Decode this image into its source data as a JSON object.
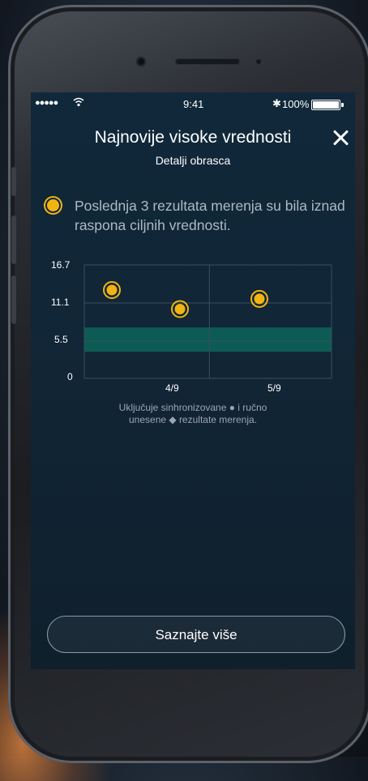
{
  "status_bar": {
    "signal": "●●●●●",
    "time": "9:41",
    "bluetooth": "✱",
    "battery_text": "100%",
    "battery_level": 1.0
  },
  "header": {
    "title": "Najnovije visoke vrednosti",
    "subtitle": "Detalji obrasca"
  },
  "message": {
    "text": "Poslednja 3 rezultata merenja su bila iznad raspona ciljnih vrednosti."
  },
  "chart_data": {
    "type": "scatter",
    "title": "",
    "y_ticks": [
      "16.7",
      "11.1",
      "5.5",
      "0"
    ],
    "ylim": [
      0,
      16.7
    ],
    "target_range": [
      3.9,
      7.5
    ],
    "x_labels": [
      "4/9",
      "5/9"
    ],
    "points": [
      {
        "x": "4/9",
        "y": 13.0
      },
      {
        "x": "4/9",
        "y": 10.2
      },
      {
        "x": "5/9",
        "y": 11.7
      }
    ],
    "colors": {
      "point": "#f1b412",
      "target_band": "#0c5b55",
      "grid": "#3a4f60"
    }
  },
  "chart_note": {
    "line1": "Uključuje sinhronizovane ● i ručno",
    "line2": "unesene ◆ rezultate merenja."
  },
  "cta": {
    "label": "Saznajte više"
  }
}
